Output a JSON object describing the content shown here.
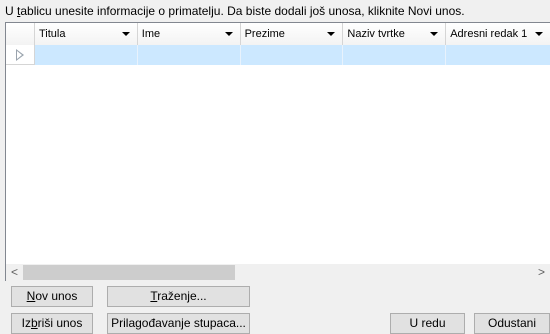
{
  "instruction": {
    "pre": "U ",
    "accel": "t",
    "post": "ablicu unesite informacije o primatelju. Da biste dodali još unosa, kliknite Novi unos."
  },
  "columns": [
    "Titula",
    "Ime",
    "Prezime",
    "Naziv tvrtke",
    "Adresni redak 1"
  ],
  "scroll": {
    "left": "<",
    "right": ">"
  },
  "buttons": {
    "new_entry": {
      "accel": "N",
      "rest": "ov unos"
    },
    "find": {
      "pre": "",
      "accel": "T",
      "rest": "raženje..."
    },
    "delete_entry": {
      "pre": "Iz",
      "accel": "b",
      "rest": "riši unos"
    },
    "customize": {
      "label": "Prilagođavanje stupaca..."
    },
    "ok": {
      "label": "U redu"
    },
    "cancel": {
      "label": "Odustani"
    }
  }
}
